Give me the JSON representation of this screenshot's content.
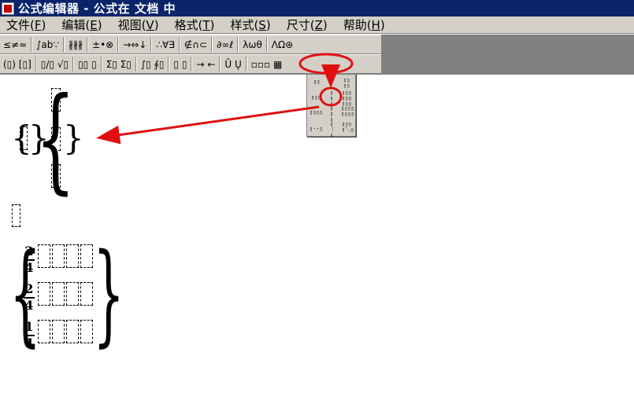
{
  "window": {
    "title": "公式编辑器 - 公式在 文档 中"
  },
  "menu": [
    {
      "label": "文件(",
      "key": "F",
      "tail": ")"
    },
    {
      "label": "编辑(",
      "key": "E",
      "tail": ")"
    },
    {
      "label": "视图(",
      "key": "V",
      "tail": ")"
    },
    {
      "label": "格式(",
      "key": "T",
      "tail": ")"
    },
    {
      "label": "样式(",
      "key": "S",
      "tail": ")"
    },
    {
      "label": "尺寸(",
      "key": "Z",
      "tail": ")"
    },
    {
      "label": "帮助(",
      "key": "H",
      "tail": ")"
    }
  ],
  "toolbar_row1": [
    "≤≠≈",
    "∫ab∵",
    "∦∦∦",
    "±•⊗",
    "→⇔↓",
    "∴∀∃",
    "∉∩⊂",
    "∂∞ℓ",
    "λωθ",
    "ΛΩ⊛"
  ],
  "toolbar_row2": [
    "(▯) [▯]",
    "▯/▯ √▯",
    "▯▯ ▯",
    "Σ▯ Σ▯",
    "∫▯ ∮▯",
    "▯ ▯",
    "→ ←",
    "Ū Ų",
    "▫▫▫ ▦"
  ],
  "fractions": [
    {
      "num": "2",
      "den": "4"
    },
    {
      "num": "2",
      "den": "4"
    },
    {
      "num": "1",
      "den": "4"
    }
  ],
  "colors": {
    "annotation": "#e01010",
    "titlebar": "#0a246a",
    "chrome": "#d4d0c8"
  }
}
